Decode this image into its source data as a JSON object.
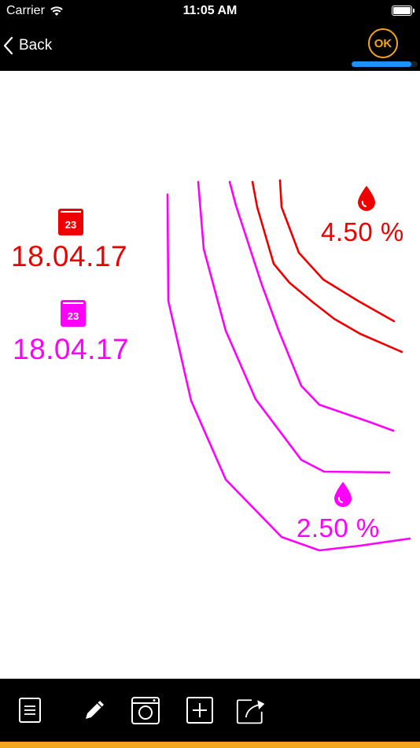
{
  "status_bar": {
    "carrier": "Carrier",
    "time": "11:05 AM"
  },
  "nav": {
    "back_label": "Back",
    "ok_label": "OK",
    "progress_fraction": 0.9,
    "colors": {
      "background": "#000000",
      "accent": "#f3a51e",
      "progress": "#1e90ff"
    }
  },
  "markers": [
    {
      "calendar_day": "23",
      "date": "18.04.17",
      "color": "#ee0000"
    },
    {
      "calendar_day": "23",
      "date": "18.04.17",
      "color": "#ff00ff"
    }
  ],
  "levels": [
    {
      "value": "4.50 %",
      "color": "#ee0000",
      "icon": "drop-icon"
    },
    {
      "value": "2.50 %",
      "color": "#ff00ff",
      "icon": "drop-icon"
    }
  ],
  "toolbar": {
    "items": [
      {
        "name": "notes",
        "icon": "note-icon"
      },
      {
        "name": "edit",
        "icon": "pencil-icon"
      },
      {
        "name": "camera",
        "icon": "camera-icon"
      },
      {
        "name": "add",
        "icon": "plus-icon"
      },
      {
        "name": "share",
        "icon": "share-icon"
      }
    ]
  }
}
